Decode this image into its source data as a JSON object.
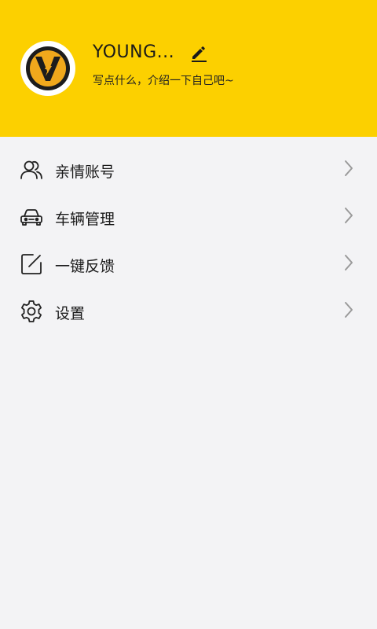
{
  "profile": {
    "username": "YOUNG...",
    "bio": "写点什么，介绍一下自己吧~",
    "avatar_icon": "v-logo-icon",
    "edit_icon": "pencil-icon"
  },
  "menu": {
    "items": [
      {
        "label": "亲情账号",
        "icon": "family-account-icon"
      },
      {
        "label": "车辆管理",
        "icon": "car-icon"
      },
      {
        "label": "一键反馈",
        "icon": "feedback-icon"
      },
      {
        "label": "设置",
        "icon": "gear-icon"
      }
    ],
    "chevron_icon": "chevron-right-icon"
  },
  "colors": {
    "header_background": "#fcd000",
    "page_background": "#f3f3f5",
    "avatar_inner": "#f0a81c",
    "text_primary": "#1a1a1a",
    "chevron": "#9a9a9a"
  }
}
